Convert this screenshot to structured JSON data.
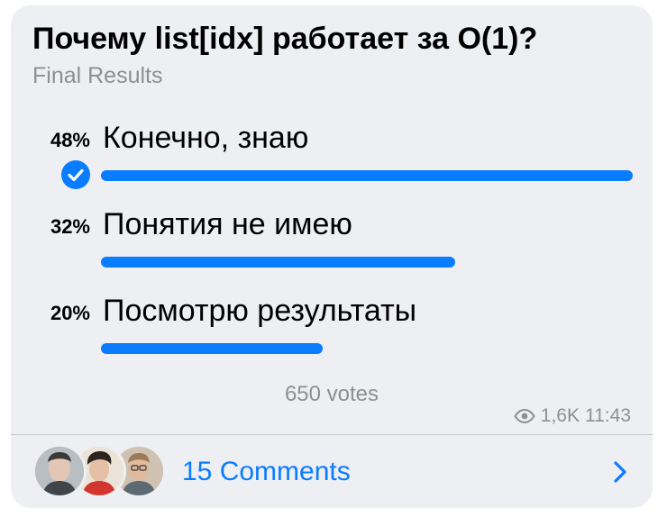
{
  "poll": {
    "question": "Почему list[idx] работает за O(1)?",
    "status": "Final Results",
    "options": [
      {
        "percent": "48%",
        "label": "Конечно, знаю",
        "share": 0.48,
        "selected": true
      },
      {
        "percent": "32%",
        "label": "Понятия не имею",
        "share": 0.32,
        "selected": false
      },
      {
        "percent": "20%",
        "label": "Посмотрю результаты",
        "share": 0.2,
        "selected": false
      }
    ],
    "votes": "650 votes",
    "views": "1,6K",
    "time": "11:43"
  },
  "comments": {
    "label": "15 Comments"
  },
  "colors": {
    "accent": "#0a7cff",
    "bubble": "#eeeff3",
    "muted": "#8e8e93"
  },
  "icons": {
    "selected": "check-circle-icon",
    "views": "eye-icon",
    "open": "chevron-right-icon"
  }
}
